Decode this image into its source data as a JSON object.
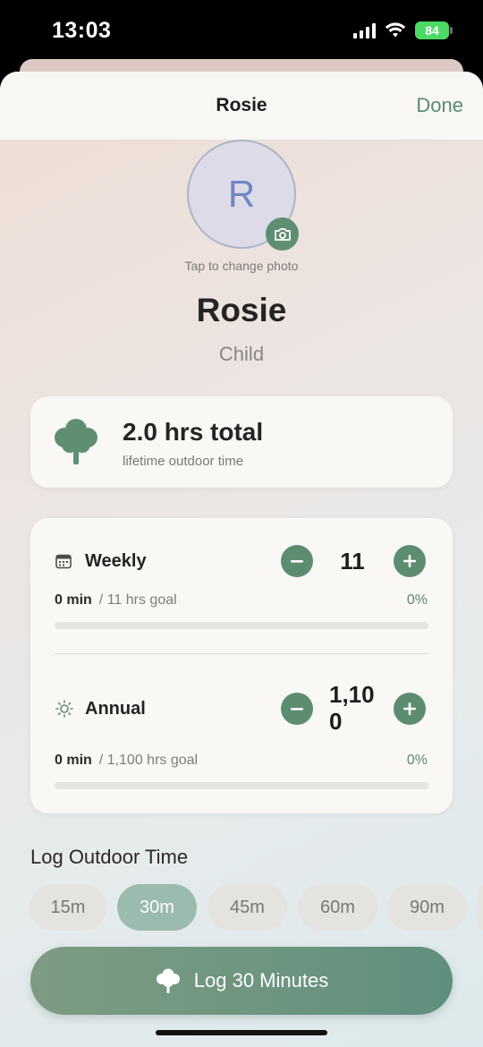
{
  "status_bar": {
    "time": "13:03",
    "battery": "84",
    "icons": [
      "signal-icon",
      "wifi-icon",
      "battery-icon"
    ]
  },
  "nav": {
    "title": "Rosie",
    "done_label": "Done"
  },
  "profile": {
    "avatar_initial": "R",
    "photo_hint": "Tap to change photo",
    "name": "Rosie",
    "role": "Child"
  },
  "summary": {
    "icon": "tree-icon",
    "total": "2.0 hrs total",
    "label": "lifetime outdoor time"
  },
  "goals": {
    "weekly": {
      "icon": "calendar-icon",
      "title": "Weekly",
      "value": "11",
      "progress": "0 min",
      "goal": "/ 11 hrs goal",
      "percent_label": "0%",
      "progress_fraction": 0
    },
    "annual": {
      "icon": "sun-icon",
      "title": "Annual",
      "value": "1,10\n0",
      "progress": "0 min",
      "goal": "/ 1,100 hrs goal",
      "percent_label": "0%",
      "progress_fraction": 0
    }
  },
  "log": {
    "section_title": "Log Outdoor Time",
    "chips": [
      "15m",
      "30m",
      "45m",
      "60m",
      "90m"
    ],
    "selected_chip": "30m",
    "button_label": "Log 30 Minutes"
  },
  "colors": {
    "accent": "#5d8d70",
    "done": "#5a8a72",
    "chip_selected": "#9bbab0"
  }
}
